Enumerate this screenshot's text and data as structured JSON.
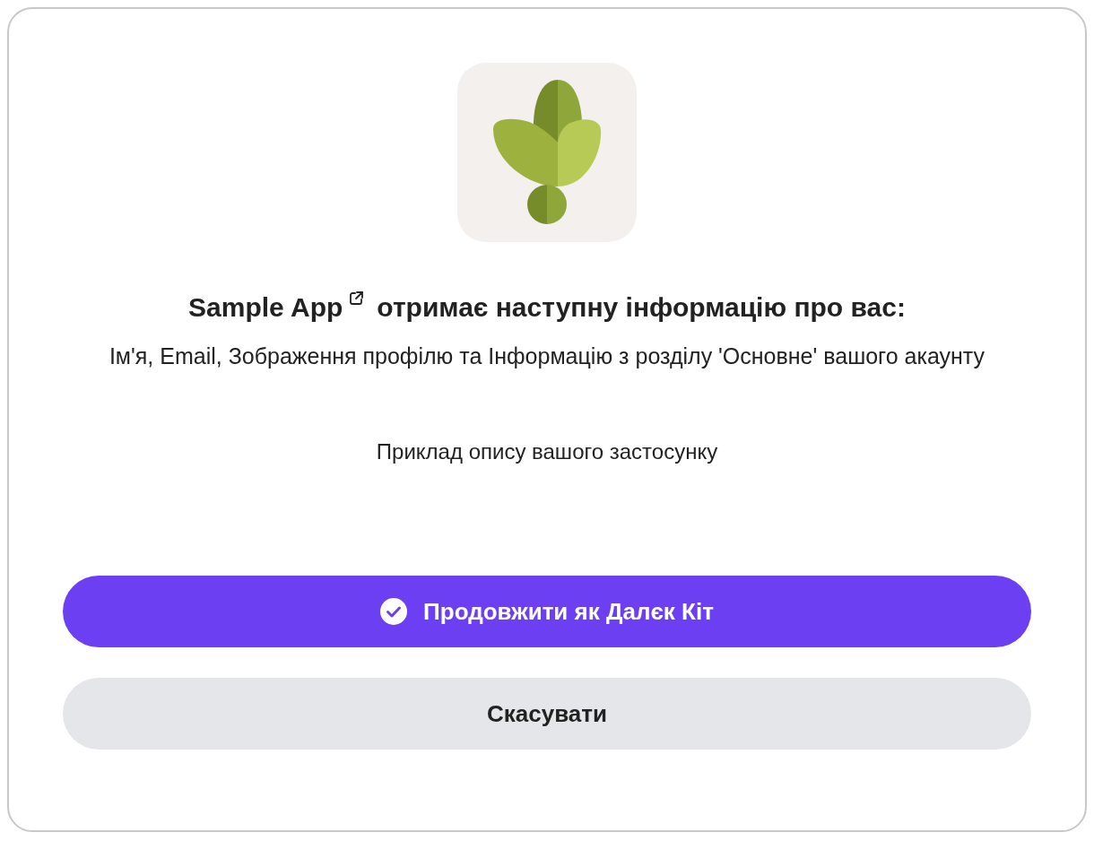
{
  "app_name": "Sample App",
  "heading_rest": "отримає наступну інформацію про вас:",
  "scopes": "Ім'я, Email, Зображення профілю та Інформацію з розділу 'Основне' вашого акаунту",
  "app_description": "Приклад опису вашого застосунку",
  "buttons": [
    {
      "label": "Продовжити як Далєк Кіт",
      "kind": "primary"
    },
    {
      "label": "Скасувати",
      "kind": "secondary"
    }
  ]
}
